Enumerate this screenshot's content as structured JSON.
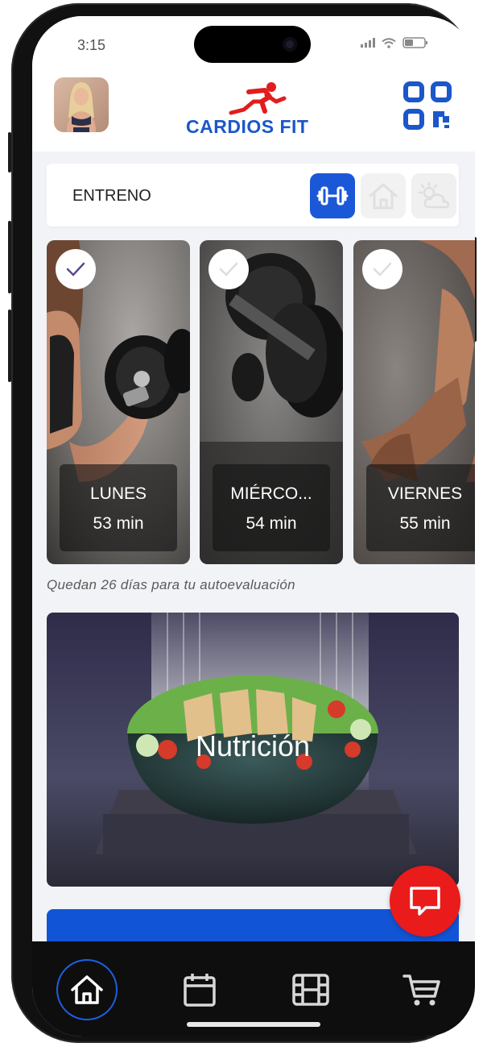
{
  "status_bar": {
    "time": "3:15"
  },
  "header": {
    "app_name": "CARDIOS FIT",
    "avatar_icon": "user-photo-avatar",
    "qr_icon": "qr-code-icon"
  },
  "segment": {
    "label": "ENTRENO",
    "options": [
      "dumbbell-icon",
      "home-icon",
      "weather-icon"
    ],
    "active": "dumbbell-icon"
  },
  "workouts": [
    {
      "day": "LUNES",
      "duration": "53 min",
      "completed": true
    },
    {
      "day": "MIÉRCO...",
      "duration": "54 min",
      "completed": false
    },
    {
      "day": "VIERNES",
      "duration": "55 min",
      "completed": false
    }
  ],
  "evaluation_note": "Quedan 26 días para tu autoevaluación",
  "nutrition": {
    "title": "Nutrición"
  },
  "bottom_nav": {
    "items": [
      "home-icon",
      "calendar-icon",
      "video-icon",
      "cart-icon"
    ],
    "active": "home-icon"
  },
  "colors": {
    "brand_blue": "#1b57c9",
    "active_blue": "#1a58d8",
    "chat_red": "#ea1b1b",
    "nav_dark": "#0e0e0e"
  }
}
